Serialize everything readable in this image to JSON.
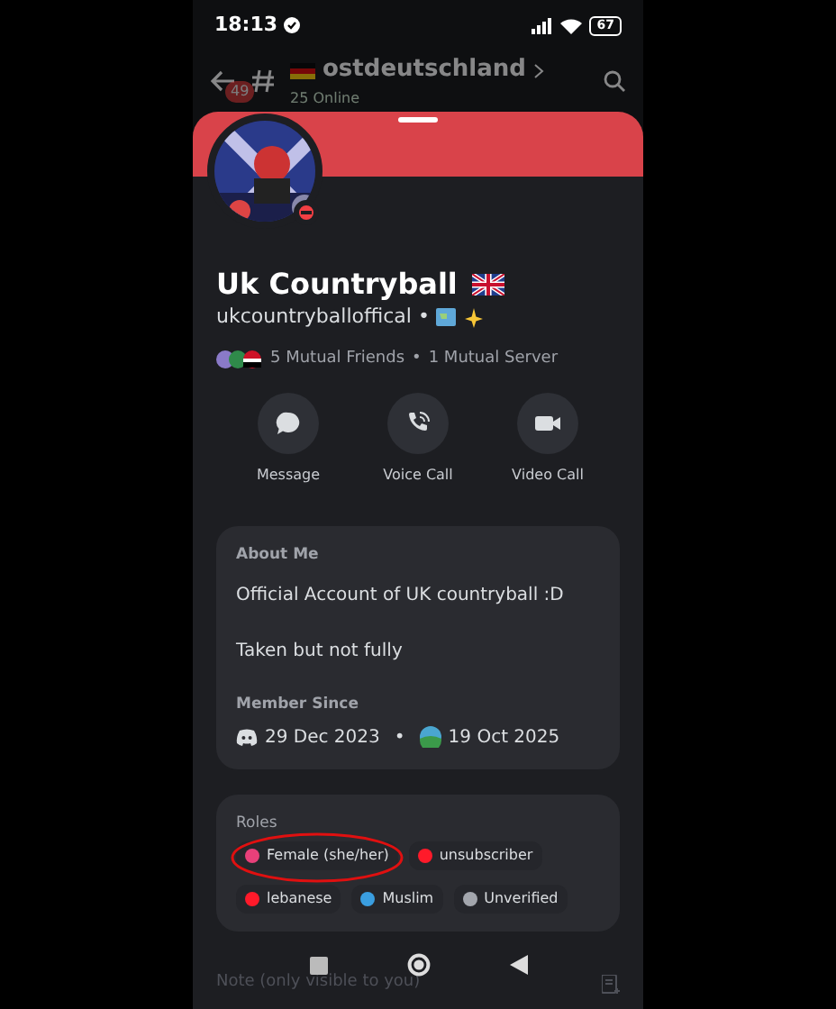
{
  "status_bar": {
    "time": "18:13",
    "battery": "67"
  },
  "channel_header": {
    "unread": "49",
    "name": "ostdeutschland",
    "online": "25 Online"
  },
  "profile": {
    "do_not_disturb": true,
    "display_name": "Uk Countryball",
    "username": "ukcountryballoffical •",
    "mutual_friends": "5 Mutual Friends",
    "mutual_separator": "•",
    "mutual_servers": "1 Mutual Server"
  },
  "actions": [
    {
      "kind": "message",
      "label": "Message"
    },
    {
      "kind": "voice",
      "label": "Voice Call"
    },
    {
      "kind": "video",
      "label": "Video Call"
    }
  ],
  "about": {
    "heading": "About Me",
    "lines": [
      "Official Account of UK countryball :D",
      "Taken but not fully"
    ],
    "member_heading": "Member Since",
    "discord_date": "29 Dec 2023",
    "date_separator": "•",
    "server_date": "19 Oct 2025"
  },
  "roles": {
    "heading": "Roles",
    "items": [
      {
        "name": "Female (she/her)",
        "color": "#e8407a",
        "circled": true
      },
      {
        "name": "unsubscriber",
        "color": "#ff1a2a",
        "circled": false
      },
      {
        "name": "lebanese",
        "color": "#ff1a2a",
        "circled": false
      },
      {
        "name": "Muslim",
        "color": "#3a9ee0",
        "circled": false
      },
      {
        "name": "Unverified",
        "color": "#a3a6ad",
        "circled": false
      }
    ]
  },
  "note": {
    "placeholder": "Note (only visible to you)"
  }
}
